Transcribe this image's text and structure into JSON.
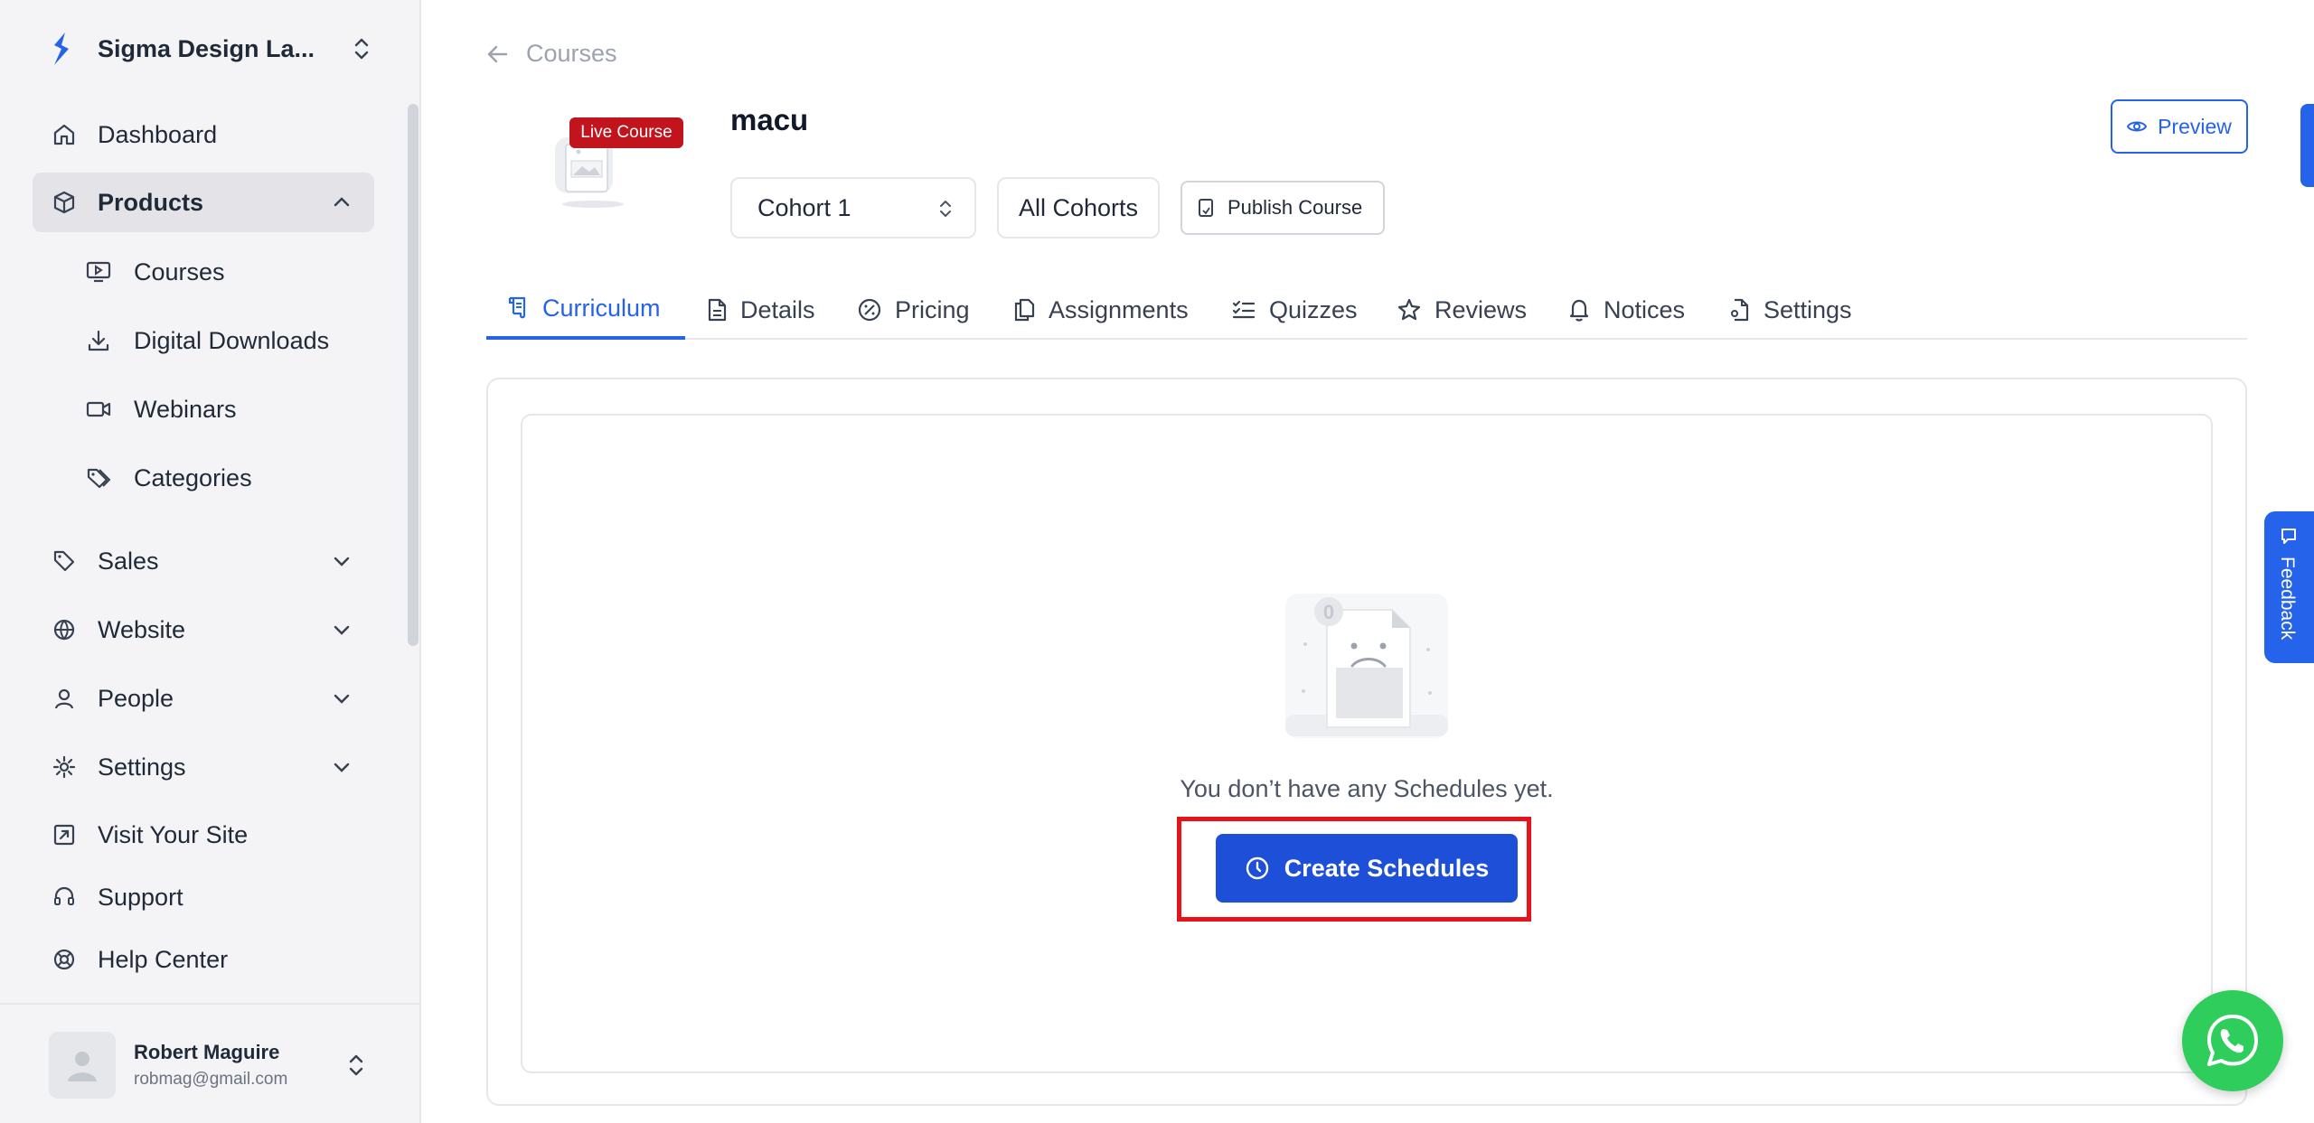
{
  "sidebar": {
    "brand_name": "Sigma Design La...",
    "items": [
      {
        "label": "Dashboard",
        "icon": "home-icon"
      },
      {
        "label": "Products",
        "icon": "box-icon",
        "expanded": true
      },
      {
        "label": "Courses",
        "icon": "monitor-play-icon"
      },
      {
        "label": "Digital Downloads",
        "icon": "download-icon"
      },
      {
        "label": "Webinars",
        "icon": "video-icon"
      },
      {
        "label": "Categories",
        "icon": "tags-icon"
      },
      {
        "label": "Sales",
        "icon": "tag-icon"
      },
      {
        "label": "Website",
        "icon": "globe-icon"
      },
      {
        "label": "People",
        "icon": "user-icon"
      },
      {
        "label": "Settings",
        "icon": "gear-icon"
      },
      {
        "label": "Visit Your Site",
        "icon": "external-link-icon"
      },
      {
        "label": "Support",
        "icon": "headset-icon"
      },
      {
        "label": "Help Center",
        "icon": "life-buoy-icon"
      }
    ],
    "user": {
      "name": "Robert Maguire",
      "email": "robmag@gmail.com"
    }
  },
  "header": {
    "back_label": "Courses",
    "badge": "Live Course",
    "course_title": "macu",
    "cohort_selected": "Cohort 1",
    "all_cohorts_label": "All Cohorts",
    "publish_label": "Publish Course",
    "preview_label": "Preview"
  },
  "tabs": [
    {
      "label": "Curriculum",
      "active": true
    },
    {
      "label": "Details"
    },
    {
      "label": "Pricing"
    },
    {
      "label": "Assignments"
    },
    {
      "label": "Quizzes"
    },
    {
      "label": "Reviews"
    },
    {
      "label": "Notices"
    },
    {
      "label": "Settings"
    }
  ],
  "empty_state": {
    "badge_count": "0",
    "message": "You don’t have any Schedules yet.",
    "button_label": "Create Schedules"
  },
  "feedback_label": "Feedback",
  "colors": {
    "primary": "#2563eb",
    "button": "#1d4fd8",
    "badge_red": "#c1141d",
    "highlight": "#e5141b",
    "whatsapp": "#2fce5c"
  }
}
